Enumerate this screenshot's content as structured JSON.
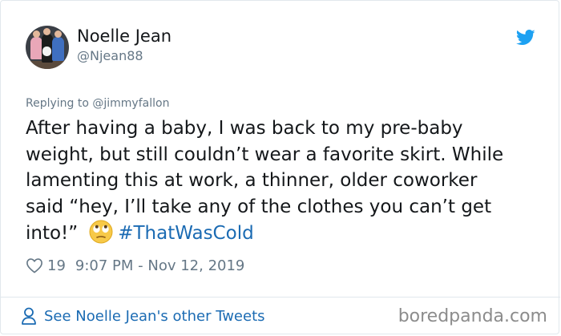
{
  "author": {
    "display_name": "Noelle Jean",
    "handle": "@Njean88"
  },
  "tweet": {
    "reply_context": "Replying to @jimmyfallon",
    "lines": [
      "After having a baby, I was back to my pre-baby",
      "weight, but still couldn’t wear a favorite skirt.  While",
      "lamenting this at work, a thinner, older coworker",
      "said “hey, I’ll take any of the clothes you can’t get",
      "into!”"
    ],
    "emoji": "face-with-rolling-eyes-emoji",
    "hashtag": "#ThatWasCold",
    "likes": "19",
    "timestamp": "9:07 PM - Nov 12, 2019"
  },
  "footer": {
    "see_more_label": "See Noelle Jean's other Tweets",
    "watermark": "boredpanda.com"
  },
  "colors": {
    "twitter_blue": "#1da1f2",
    "link_blue": "#1b6bb3",
    "secondary_text": "#657786",
    "divider": "#e1e8ed"
  },
  "icons": {
    "brand": "twitter-bird-icon",
    "like": "heart-outline-icon",
    "profile": "person-outline-icon"
  }
}
